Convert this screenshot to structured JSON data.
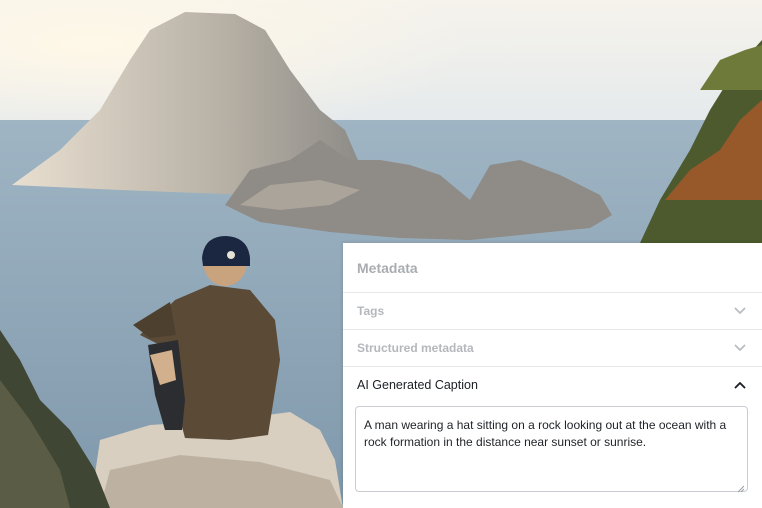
{
  "panel": {
    "title": "Metadata",
    "sections": [
      {
        "label": "Tags",
        "expanded": false,
        "icon": "chevron-down-icon"
      },
      {
        "label": "Structured metadata",
        "expanded": false,
        "icon": "chevron-down-icon"
      },
      {
        "label": "AI Generated Caption",
        "expanded": true,
        "icon": "chevron-up-icon"
      }
    ],
    "caption": "A man wearing a hat sitting on a rock looking out at the ocean with a rock formation in the distance near sunset or sunrise."
  },
  "colors": {
    "panel_bg": "#ffffff",
    "divider": "#e6e8ea",
    "muted_text": "#b4b8bc",
    "active_text": "#1b1f24"
  }
}
